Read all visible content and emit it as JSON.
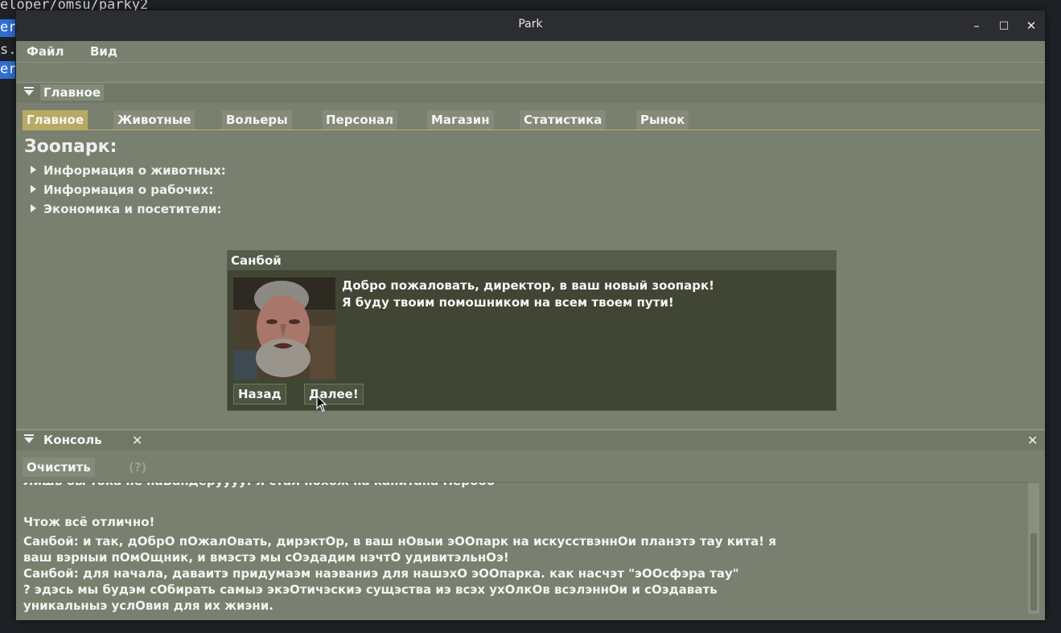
{
  "terminal": {
    "line0": "eloper/omsu/parky2",
    "chip1": "er",
    "line2": "s.",
    "chip3": "er"
  },
  "window": {
    "title": "Park",
    "minimize": "–",
    "maximize": "□",
    "close": "✕"
  },
  "menu": {
    "file": "Файл",
    "view": "Вид"
  },
  "main_dock": {
    "title": "Главное"
  },
  "tabs": [
    "Главное",
    "Животные",
    "Вольеры",
    "Персонал",
    "Магазин",
    "Статистика",
    "Рынок"
  ],
  "zoo": {
    "heading": "Зоопарк:",
    "sections": [
      "Информация о животных:",
      "Информация о рабочих:",
      "Экономика и посетители:"
    ]
  },
  "dialog": {
    "title": "Санбой",
    "message_line1": "Добро пожаловать, директор, в ваш новый зоопарк!",
    "message_line2": "Я буду твоим помошником на всем твоем пути!",
    "back": "Назад",
    "next": "Далее!"
  },
  "console_dock": {
    "title": "Консоль",
    "close_tab": "✕",
    "close_dock": "✕",
    "clear": "Очистить",
    "help": "(?)",
    "lines": [
      "Лишь бы тока не наВандеруууу. Я стал похож на капитана Нербоб",
      "Чтож всё отлично!",
      "Санбой: и так, дОбрО пОжалОвать, дирэктОр, в ваш нОвыи эООпарк на искусствэннОи планэтэ тау кита! я",
      "ваш вэрныи пОмОщник, и вмэстэ мы сОэдадим нэчтО удивитэльнОэ!",
      "Санбой: для начала, даваитэ придумаэм наэваниэ для нашэхО эООпарка. как насчэт \"эООсфэра тау\"",
      "? эдэсь мы будэм сОбирать самыэ экэОтичэскиэ сущэства иэ всэх ухОлкОв всэлэннОи и сОэдавать",
      "уникальныэ услОвия для их жиэни."
    ]
  },
  "colors": {
    "background": "#7a806f",
    "dialog": "#404633",
    "active_tab": "#b8a964",
    "titlebar": "#2c2d30"
  }
}
